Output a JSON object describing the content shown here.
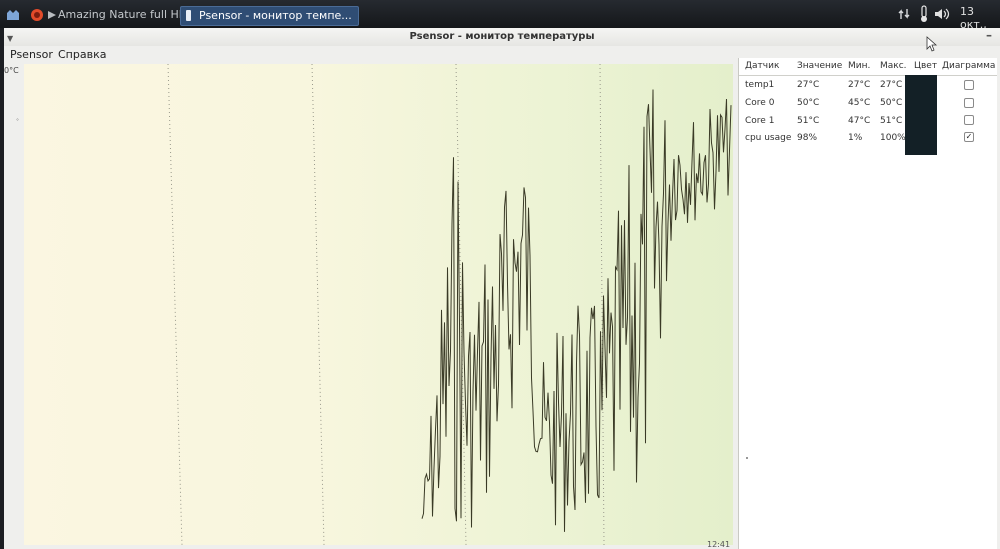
{
  "taskbar": {
    "tasks": [
      {
        "label": "Amazing Nature full HD ...",
        "active": false
      },
      {
        "label": "Psensor - монитор темпе...",
        "active": true
      }
    ],
    "clock": "13 окт.,"
  },
  "window": {
    "title": "Psensor - монитор температуры",
    "menu": [
      "Psensor",
      "Справка"
    ]
  },
  "graph": {
    "y_top_label": "0°C",
    "x_time_label": "12:41",
    "line_color": "#3a3a26"
  },
  "sensor_table": {
    "headers": [
      "Датчик",
      "Значение",
      "Мин.",
      "Макс.",
      "Цвет",
      "Диаграмма"
    ],
    "rows": [
      {
        "name": "temp1",
        "value": "27°C",
        "min": "27°C",
        "max": "27°C",
        "color": "#132026",
        "graph": false
      },
      {
        "name": "Core 0",
        "value": "50°C",
        "min": "45°C",
        "max": "50°C",
        "color": "#132026",
        "graph": false
      },
      {
        "name": "Core 1",
        "value": "51°C",
        "min": "47°C",
        "max": "51°C",
        "color": "#132026",
        "graph": false
      },
      {
        "name": "cpu usage",
        "value": "98%",
        "min": "1%",
        "max": "100%",
        "color": "#132026",
        "graph": true
      }
    ]
  }
}
